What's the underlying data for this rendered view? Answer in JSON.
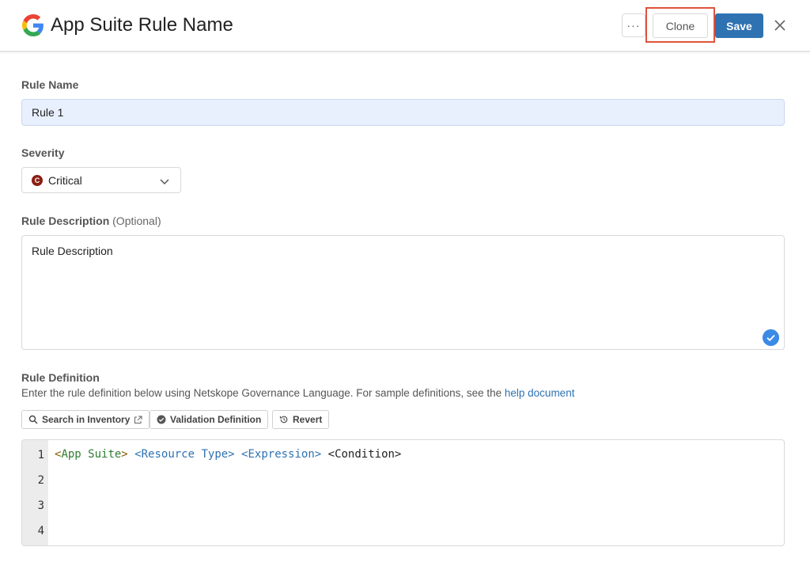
{
  "header": {
    "title": "App Suite Rule Name",
    "more_label": "···",
    "clone_label": "Clone",
    "save_label": "Save"
  },
  "form": {
    "rule_name_label": "Rule Name",
    "rule_name_value": "Rule 1",
    "severity_label": "Severity",
    "severity_badge": "C",
    "severity_value": "Critical",
    "description_label": "Rule Description",
    "description_optional": "(Optional)",
    "description_value": "Rule Description",
    "definition_label": "Rule Definition",
    "definition_hint": "Enter the rule definition below using Netskope Governance Language. For sample definitions, see the",
    "help_link": "help document"
  },
  "toolbar": {
    "search_label": "Search in Inventory",
    "validate_label": "Validation Definition",
    "revert_label": "Revert"
  },
  "editor": {
    "line_numbers": [
      "1",
      "2",
      "3",
      "4"
    ],
    "tokens": {
      "app_open": "<",
      "app_inner": "App Suite",
      "app_close": ">",
      "resource": "<Resource Type>",
      "expression": "<Expression>",
      "condition": "<Condition>"
    }
  },
  "colors": {
    "accent": "#2f72b1",
    "highlight": "#e0533d",
    "critical": "#8b1e14",
    "field_bg": "#e8f0fe"
  }
}
